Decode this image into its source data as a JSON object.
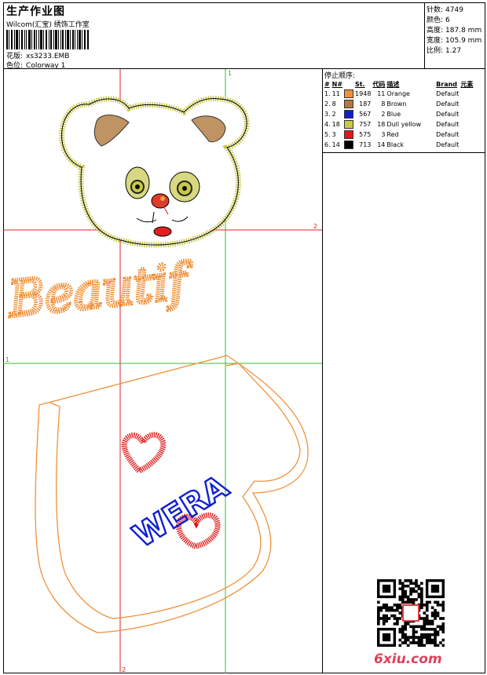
{
  "header": {
    "title": "生产作业图",
    "company": "Wilcom(汇宝) 绣饰工作室",
    "design_label": "花版:",
    "design_value": "xs3233.EMB",
    "colorway_label": "色位:",
    "colorway_value": "Colorway 1"
  },
  "info": [
    {
      "label": "针数:",
      "value": "4749"
    },
    {
      "label": "颜色:",
      "value": "6"
    },
    {
      "label": "高度:",
      "value": "187.8 mm"
    },
    {
      "label": "宽度:",
      "value": "105.9 mm"
    },
    {
      "label": "比例:",
      "value": "1.27"
    }
  ],
  "stop_sequence": {
    "title": "停止顺序:",
    "columns": [
      "#",
      "N#",
      "St.",
      "代码",
      "描述",
      "Brand",
      "元素"
    ],
    "rows": [
      {
        "idx": "1.",
        "n": "11",
        "color": "#f0913a",
        "st": "1948",
        "code": "11",
        "desc": "Orange",
        "brand": "Default",
        "elem": ""
      },
      {
        "idx": "2.",
        "n": "8",
        "color": "#b07a3c",
        "st": "187",
        "code": "8",
        "desc": "Brown",
        "brand": "Default",
        "elem": ""
      },
      {
        "idx": "3.",
        "n": "2",
        "color": "#1020d0",
        "st": "567",
        "code": "2",
        "desc": "Blue",
        "brand": "Default",
        "elem": ""
      },
      {
        "idx": "4.",
        "n": "18",
        "color": "#c8c848",
        "st": "757",
        "code": "18",
        "desc": "Dull yellow",
        "brand": "Default",
        "elem": ""
      },
      {
        "idx": "5.",
        "n": "3",
        "color": "#e01818",
        "st": "575",
        "code": "3",
        "desc": "Red",
        "brand": "Default",
        "elem": ""
      },
      {
        "idx": "6.",
        "n": "14",
        "color": "#000000",
        "st": "713",
        "code": "14",
        "desc": "Black",
        "brand": "Default",
        "elem": ""
      }
    ]
  },
  "canvas": {
    "marker_top": "1",
    "marker_right": "2",
    "marker_left": "1",
    "marker_bottom": "2",
    "word_beautiful": "Beautif",
    "word_wera": "WERA"
  },
  "watermark": "6xiu.com",
  "colors": {
    "orange": "#f0913a",
    "guide_red": "#e02020",
    "guide_green": "#30c030"
  }
}
